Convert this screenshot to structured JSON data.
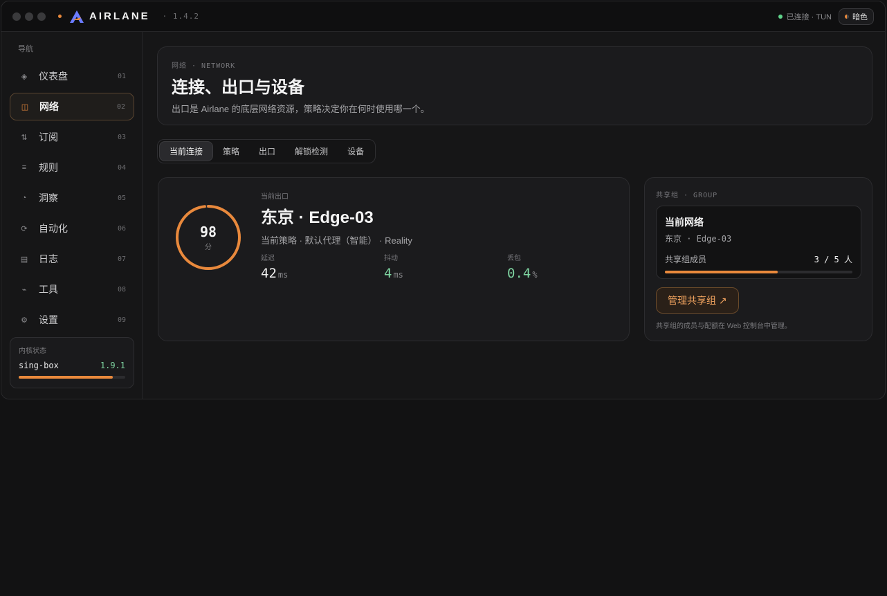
{
  "app": {
    "name": "AIRLANE",
    "version": "· 1.4.2"
  },
  "titlebar": {
    "connection": "已连接 · TUN",
    "theme_label": "暗色"
  },
  "sidebar": {
    "heading": "导航",
    "items": [
      {
        "label": "仪表盘",
        "num": "01",
        "icon": "dashboard-icon",
        "glyph": "◈"
      },
      {
        "label": "网络",
        "num": "02",
        "icon": "network-icon",
        "glyph": "◫"
      },
      {
        "label": "订阅",
        "num": "03",
        "icon": "subscription-icon",
        "glyph": "⇅"
      },
      {
        "label": "规则",
        "num": "04",
        "icon": "rules-icon",
        "glyph": "≡"
      },
      {
        "label": "洞察",
        "num": "05",
        "icon": "insights-icon",
        "glyph": "◔"
      },
      {
        "label": "自动化",
        "num": "06",
        "icon": "automation-icon",
        "glyph": "⟳"
      },
      {
        "label": "日志",
        "num": "07",
        "icon": "logs-icon",
        "glyph": "▤"
      },
      {
        "label": "工具",
        "num": "08",
        "icon": "tools-icon",
        "glyph": "⌁"
      },
      {
        "label": "设置",
        "num": "09",
        "icon": "settings-icon",
        "glyph": "⚙"
      }
    ],
    "kernel": {
      "title": "内核状态",
      "name": "sing-box",
      "version": "1.9.1",
      "progress": 0.88
    }
  },
  "header": {
    "eyebrow": "网络 · NETWORK",
    "title": "连接、出口与设备",
    "subtitle": "出口是 Airlane 的底层网络资源，策略决定你在何时使用哪一个。"
  },
  "tabs": [
    "当前连接",
    "策略",
    "出口",
    "解锁检测",
    "设备"
  ],
  "exit": {
    "score": "98",
    "score_unit": "分",
    "score_value": 0.98,
    "eyebrow": "当前出口",
    "name": "东京 · Edge-03",
    "policy": "当前策略 · 默认代理（智能） · Reality",
    "metrics": [
      {
        "label": "延迟",
        "value": "42",
        "unit": "ms"
      },
      {
        "label": "抖动",
        "value": "4",
        "unit": "ms"
      },
      {
        "label": "丢包",
        "value": "0.4",
        "unit": "%"
      }
    ]
  },
  "group": {
    "eyebrow": "共享组 · GROUP",
    "title": "当前网络",
    "sub": "东京 · Edge-03",
    "members_label": "共享组成员",
    "members_value": "3 / 5 人",
    "members_fraction": 0.6,
    "manage_label": "管理共享组 ↗",
    "note": "共享组的成员与配额在 Web 控制台中管理。"
  },
  "colors": {
    "accent": "#e9893c",
    "good": "#7ed3a0",
    "bg": "#161617"
  }
}
